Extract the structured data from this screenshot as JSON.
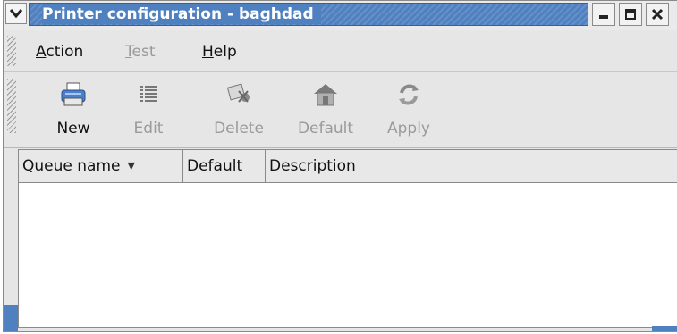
{
  "window": {
    "title": "Printer configuration - baghdad",
    "menu_icon": "chevron-down-icon",
    "buttons": [
      "minimize-icon",
      "maximize-icon",
      "close-icon"
    ]
  },
  "menubar": {
    "items": [
      {
        "label_rest": "ction",
        "label_mnemonic": "A",
        "enabled": true
      },
      {
        "label_rest": "est",
        "label_mnemonic": "T",
        "enabled": false
      },
      {
        "label_rest": "elp",
        "label_mnemonic": "H",
        "enabled": true
      }
    ]
  },
  "toolbar": {
    "items": [
      {
        "label": "New",
        "icon": "printer-icon",
        "enabled": true
      },
      {
        "label": "Edit",
        "icon": "edit-list-icon",
        "enabled": false
      },
      {
        "label": "Delete",
        "icon": "delete-icon",
        "enabled": false
      },
      {
        "label": "Default",
        "icon": "home-icon",
        "enabled": false
      },
      {
        "label": "Apply",
        "icon": "apply-icon",
        "enabled": false
      }
    ]
  },
  "list": {
    "columns": [
      {
        "label": "Queue name",
        "sorted": true
      },
      {
        "label": "Default"
      },
      {
        "label": "Description"
      }
    ],
    "rows": []
  },
  "colors": {
    "title_bar": "#4f80c0",
    "disabled_text": "#9a9a9a"
  }
}
